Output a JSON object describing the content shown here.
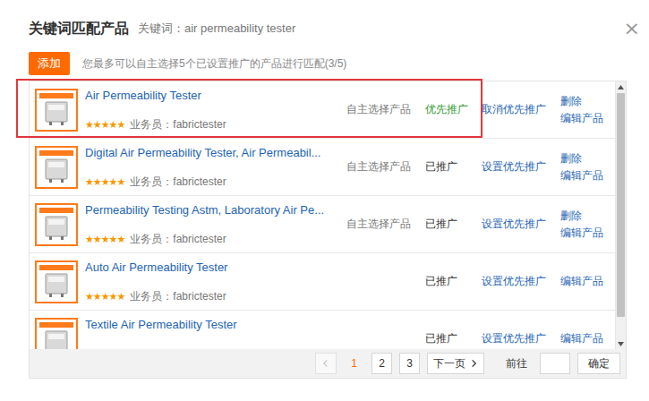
{
  "dialog": {
    "title": "关键词匹配产品",
    "keyword_label": "关键词：air permeability tester",
    "close": "×"
  },
  "toolbar": {
    "add_button": "添加",
    "hint": "您最多可以自主选择5个已设置推广的产品进行匹配(3/5)"
  },
  "products": [
    {
      "name": "Air Permeability Tester",
      "stars": 5,
      "salesperson": "业务员：fabrictester",
      "source": "自主选择产品",
      "status": "优先推广",
      "priority": true,
      "action": "取消优先推广",
      "delete": "删除",
      "edit": "编辑产品",
      "highlighted": true
    },
    {
      "name": "Digital Air Permeability Tester, Air Permeabil...",
      "stars": 5,
      "salesperson": "业务员：fabrictester",
      "source": "自主选择产品",
      "status": "已推广",
      "priority": false,
      "action": "设置优先推广",
      "delete": "删除",
      "edit": "编辑产品",
      "highlighted": false
    },
    {
      "name": "Permeability Testing Astm, Laboratory Air Pe...",
      "stars": 5,
      "salesperson": "业务员：fabrictester",
      "source": "自主选择产品",
      "status": "已推广",
      "priority": false,
      "action": "设置优先推广",
      "delete": "删除",
      "edit": "编辑产品",
      "highlighted": false
    },
    {
      "name": "Auto Air Permeability Tester",
      "stars": 5,
      "salesperson": "业务员：fabrictester",
      "status": "已推广",
      "priority": false,
      "action": "设置优先推广",
      "edit": "编辑产品",
      "highlighted": false
    },
    {
      "name": "Textile Air Permeability Tester",
      "status": "已推广",
      "priority": false,
      "action": "设置优先推广",
      "edit": "编辑产品",
      "highlighted": false
    }
  ],
  "pagination": {
    "prev_disabled": true,
    "pages": [
      {
        "label": "1",
        "selected": true
      },
      {
        "label": "2",
        "selected": false
      },
      {
        "label": "3",
        "selected": false
      }
    ],
    "next": "下一页",
    "goto_label": "前往",
    "goto_value": "",
    "confirm": "确定"
  }
}
